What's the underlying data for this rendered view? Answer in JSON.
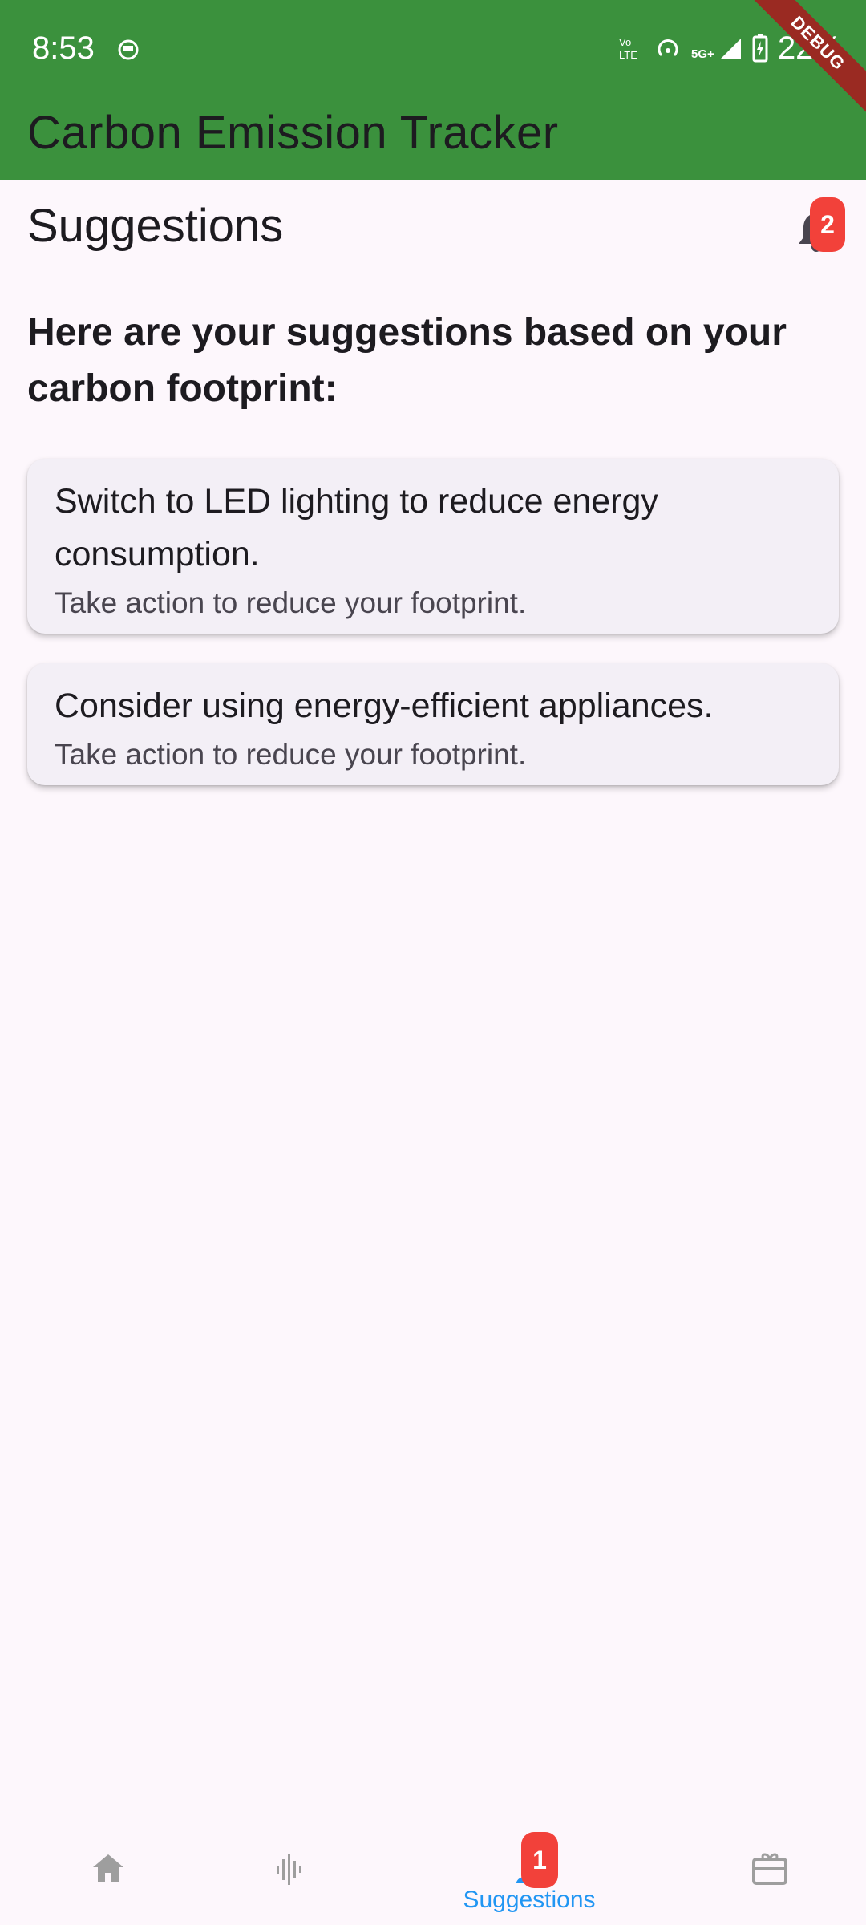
{
  "status_bar": {
    "time": "8:53",
    "battery": "22%",
    "icons": [
      "notification-app-icon",
      "volte-icon",
      "hotspot-icon",
      "signal-5g-icon",
      "battery-charging-icon"
    ]
  },
  "app_bar": {
    "title": "Carbon Emission Tracker",
    "background": "#3b913d",
    "debug_banner": "DEBUG"
  },
  "header": {
    "title": "Suggestions",
    "notification_count": "2"
  },
  "intro": "Here are your suggestions based on your carbon footprint:",
  "suggestions": [
    {
      "title": "Switch to LED lighting to reduce energy consumption.",
      "subtitle": "Take action to reduce your footprint."
    },
    {
      "title": "Consider using energy-efficient appliances.",
      "subtitle": "Take action to reduce your footprint."
    }
  ],
  "bottom_nav": {
    "items": [
      {
        "icon": "home-icon",
        "label": ""
      },
      {
        "icon": "activity-icon",
        "label": ""
      },
      {
        "icon": "person-icon",
        "label": "Suggestions",
        "selected": true,
        "badge": "1"
      },
      {
        "icon": "gift-card-icon",
        "label": ""
      }
    ],
    "selected_color": "#2196f3",
    "inactive_color": "#9e9e9e"
  },
  "colors": {
    "accent": "#3b913d",
    "badge": "#f2413a",
    "background": "#fdf7fc",
    "card": "#f3eff6"
  }
}
